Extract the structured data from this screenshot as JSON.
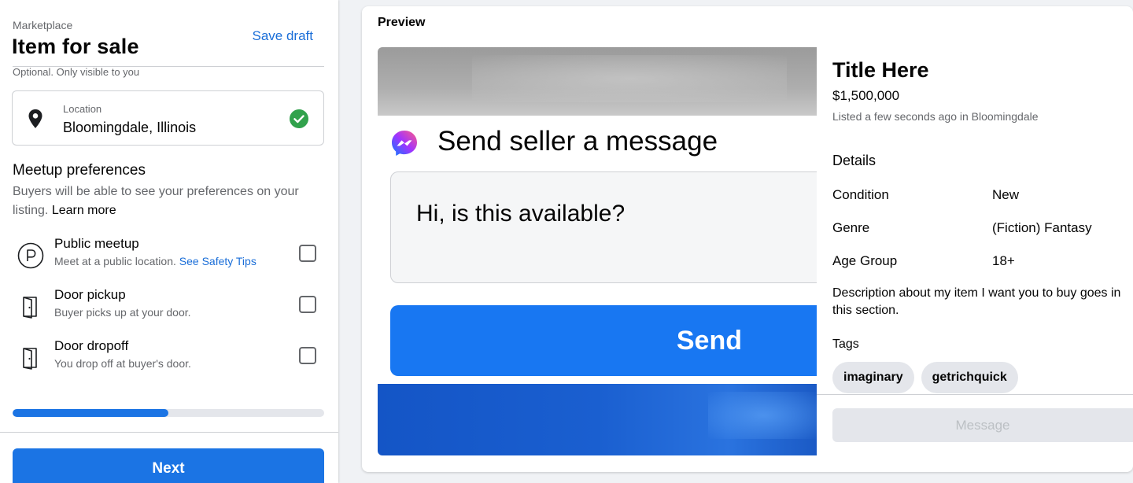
{
  "header": {
    "breadcrumb": "Marketplace",
    "title": "Item for sale",
    "save_draft_label": "Save draft",
    "optional_note": "Optional. Only visible to you"
  },
  "location": {
    "label": "Location",
    "value": "Bloomingdale, Illinois",
    "icon": "map-pin-icon",
    "status_icon": "check-circle-icon",
    "status_color": "#31a24c"
  },
  "meetup": {
    "title": "Meetup preferences",
    "description": "Buyers will be able to see your preferences on your listing.",
    "learn_more": "Learn more",
    "options": [
      {
        "icon": "parking-icon",
        "title": "Public meetup",
        "subtitle": "Meet at a public location.",
        "link": "See Safety Tips",
        "checked": false
      },
      {
        "icon": "door-icon",
        "title": "Door pickup",
        "subtitle": "Buyer picks up at your door.",
        "checked": false
      },
      {
        "icon": "door-icon",
        "title": "Door dropoff",
        "subtitle": "You drop off at buyer's door.",
        "checked": false
      }
    ]
  },
  "progress": {
    "fraction": 0.5
  },
  "footer": {
    "next_label": "Next"
  },
  "preview": {
    "label": "Preview",
    "media": {
      "message_title": "Send seller a message",
      "message_text": "Hi, is this available?",
      "send_label": "Send"
    },
    "listing": {
      "title": "Title Here",
      "price": "$1,500,000",
      "listed": "Listed a few seconds ago in Bloomingdale",
      "details_heading": "Details",
      "details": [
        {
          "key": "Condition",
          "value": "New"
        },
        {
          "key": "Genre",
          "value": "(Fiction) Fantasy"
        },
        {
          "key": "Age Group",
          "value": "18+"
        }
      ],
      "description": "Description about my item I want you to buy goes in this section.",
      "tags_heading": "Tags",
      "tags": [
        "imaginary",
        "getrichquick"
      ],
      "message_label": "Message"
    }
  },
  "colors": {
    "accent": "#1b74e4",
    "link": "#1a6ed8",
    "secondary_text": "#65676b"
  }
}
